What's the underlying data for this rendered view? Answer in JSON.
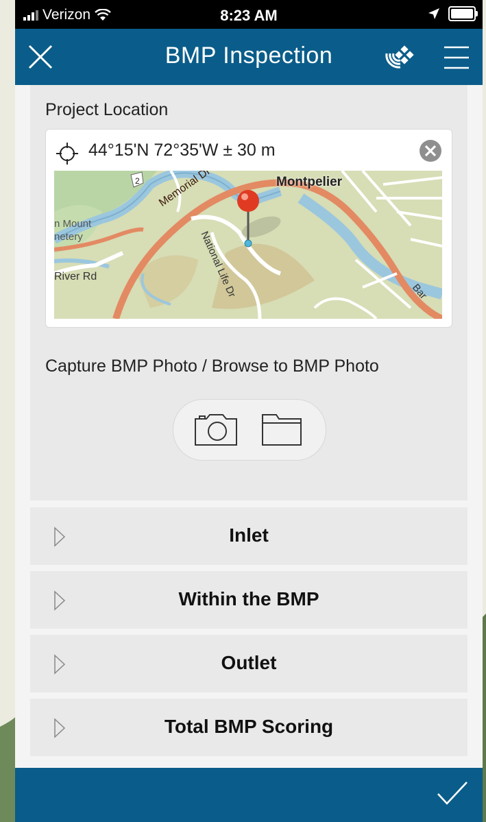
{
  "status_bar": {
    "carrier": "Verizon",
    "time": "8:23 AM"
  },
  "header": {
    "title": "BMP Inspection"
  },
  "location": {
    "label": "Project Location",
    "coordinates": "44°15'N 72°35'W ± 30 m",
    "map_labels": {
      "city": "Montpelier",
      "road1": "Memorial Dr",
      "road2": "National Life Dr",
      "road3": "River Rd",
      "route": "2",
      "place_line1": "n Mount",
      "place_line2": "netery",
      "bar": "Bar"
    }
  },
  "photo": {
    "label": "Capture BMP Photo / Browse to BMP Photo"
  },
  "groups": [
    {
      "label": "Inlet"
    },
    {
      "label": "Within the BMP"
    },
    {
      "label": "Outlet"
    },
    {
      "label": "Total BMP Scoring"
    }
  ],
  "colors": {
    "primary": "#0a5d8a",
    "card": "#e9e9e9"
  }
}
